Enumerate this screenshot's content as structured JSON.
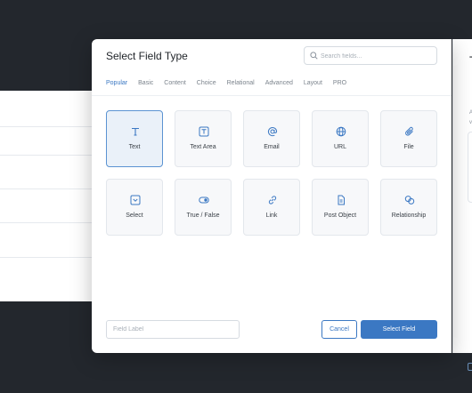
{
  "modal": {
    "title": "Select Field Type",
    "search_placeholder": "Search fields...",
    "tabs": [
      "Popular",
      "Basic",
      "Content",
      "Choice",
      "Relational",
      "Advanced",
      "Layout",
      "PRO"
    ],
    "active_tab": "Popular",
    "fields": [
      {
        "label": "Text",
        "icon": "text-icon",
        "selected": true
      },
      {
        "label": "Text Area",
        "icon": "text-area-icon",
        "selected": false
      },
      {
        "label": "Email",
        "icon": "at-icon",
        "selected": false
      },
      {
        "label": "URL",
        "icon": "globe-icon",
        "selected": false
      },
      {
        "label": "File",
        "icon": "paperclip-icon",
        "selected": false
      },
      {
        "label": "Select",
        "icon": "select-icon",
        "selected": false
      },
      {
        "label": "True / False",
        "icon": "toggle-icon",
        "selected": false
      },
      {
        "label": "Link",
        "icon": "link-icon",
        "selected": false
      },
      {
        "label": "Post Object",
        "icon": "document-icon",
        "selected": false
      },
      {
        "label": "Relationship",
        "icon": "relationship-icon",
        "selected": false
      }
    ],
    "field_label_placeholder": "Field Label",
    "cancel_label": "Cancel",
    "select_label": "Select Field"
  },
  "side_panel": {
    "title": "T",
    "line1": "A",
    "line2": "v"
  },
  "colors": {
    "accent": "#3b78c3",
    "backdrop": "#23272d",
    "tile_bg": "#f7f8fa",
    "selected_bg": "#eaf1f9"
  }
}
